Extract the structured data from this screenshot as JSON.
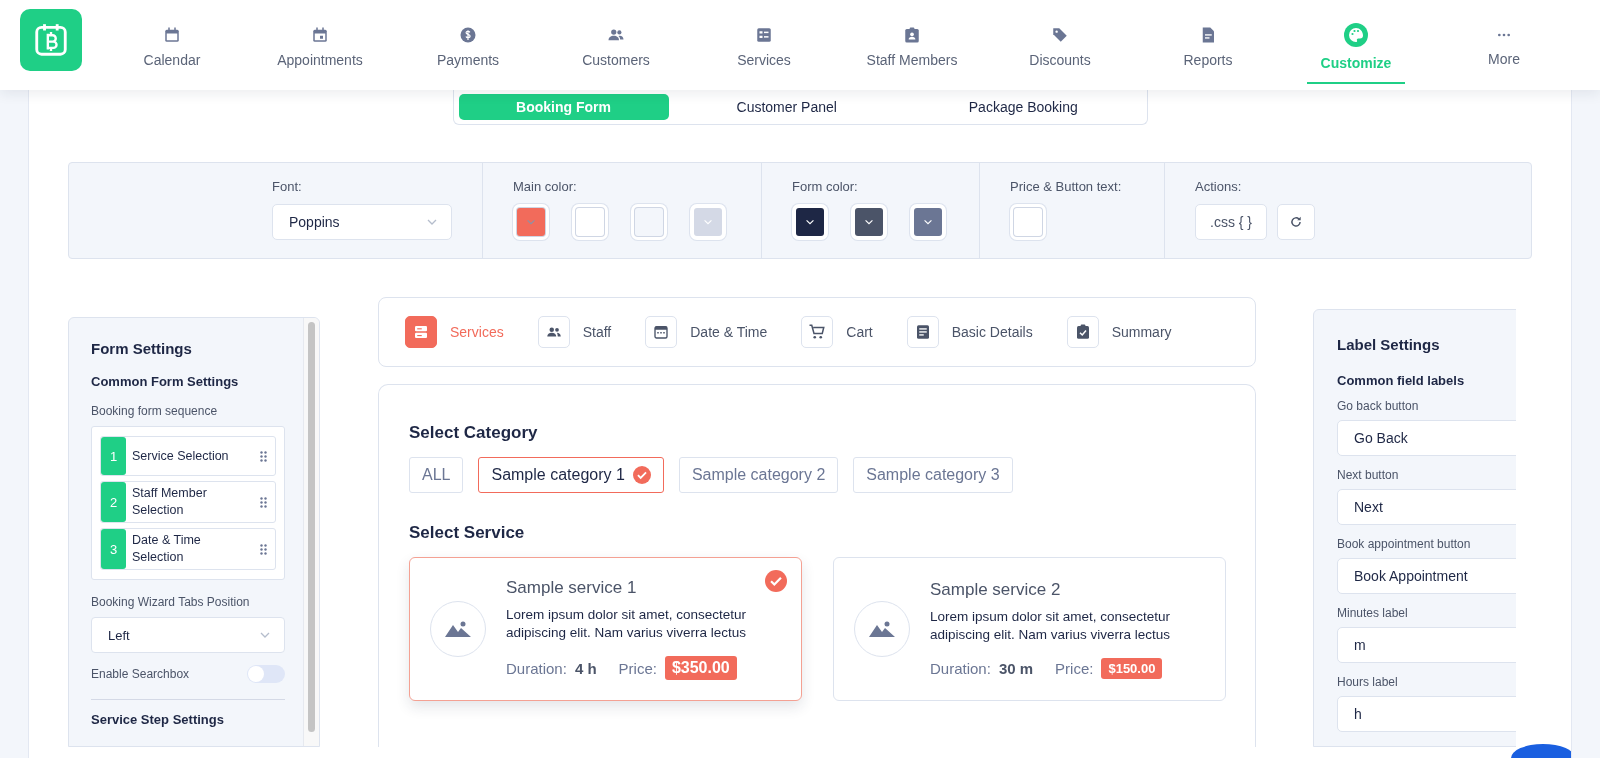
{
  "nav": {
    "items": [
      {
        "label": "Calendar",
        "selected": false
      },
      {
        "label": "Appointments",
        "selected": false
      },
      {
        "label": "Payments",
        "selected": false
      },
      {
        "label": "Customers",
        "selected": false
      },
      {
        "label": "Services",
        "selected": false
      },
      {
        "label": "Staff Members",
        "selected": false
      },
      {
        "label": "Discounts",
        "selected": false
      },
      {
        "label": "Reports",
        "selected": false
      },
      {
        "label": "Customize",
        "selected": true
      },
      {
        "label": "More",
        "selected": false
      }
    ]
  },
  "subtabs": [
    {
      "label": "Booking Form",
      "selected": true
    },
    {
      "label": "Customer Panel",
      "selected": false
    },
    {
      "label": "Package Booking",
      "selected": false
    }
  ],
  "toolbar": {
    "font": {
      "label": "Font:",
      "value": "Poppins"
    },
    "main_color": {
      "label": "Main color:",
      "swatches": [
        {
          "color": "#f26b5b",
          "caret": true
        },
        {
          "color": "#ffffff",
          "caret": false
        },
        {
          "color": "#f3f6fb",
          "caret": false
        },
        {
          "color": "#d4d9e6",
          "caret": true
        }
      ]
    },
    "form_color": {
      "label": "Form color:",
      "swatches": [
        {
          "color": "#1e2745",
          "caret": true
        },
        {
          "color": "#4b5468",
          "caret": true
        },
        {
          "color": "#6b7694",
          "caret": true
        }
      ]
    },
    "text_color": {
      "label": "Price & Button text:",
      "swatches": [
        {
          "color": "#ffffff",
          "caret": false
        }
      ]
    },
    "actions": {
      "label": "Actions:",
      "css_button": ".css { }"
    }
  },
  "form_settings": {
    "title": "Form Settings",
    "subtitle": "Common Form Settings",
    "sequence_label": "Booking form sequence",
    "sequence": [
      {
        "number": "1",
        "label": "Service Selection"
      },
      {
        "number": "2",
        "label": "Staff Member Selection"
      },
      {
        "number": "3",
        "label": "Date & Time Selection"
      }
    ],
    "tabs_position_label": "Booking Wizard Tabs Position",
    "tabs_position": "Left",
    "searchbox": {
      "label": "Enable Searchbox",
      "on": false
    },
    "next_section": "Service Step Settings"
  },
  "steps": [
    {
      "label": "Services",
      "selected": true
    },
    {
      "label": "Staff",
      "selected": false
    },
    {
      "label": "Date & Time",
      "selected": false
    },
    {
      "label": "Cart",
      "selected": false
    },
    {
      "label": "Basic Details",
      "selected": false
    },
    {
      "label": "Summary",
      "selected": false
    }
  ],
  "categories": {
    "heading": "Select Category",
    "chips": [
      {
        "label": "ALL",
        "selected": false
      },
      {
        "label": "Sample category 1",
        "selected": true
      },
      {
        "label": "Sample category 2",
        "selected": false
      },
      {
        "label": "Sample category 3",
        "selected": false
      }
    ]
  },
  "services": {
    "heading": "Select Service",
    "cards": [
      {
        "title": "Sample service 1",
        "description": "Lorem ipsum dolor sit amet, consectetur adipiscing elit. Nam varius viverra lectus",
        "duration_label": "Duration:",
        "duration": "4 h",
        "price_label": "Price:",
        "price": "$350.00",
        "selected": true
      },
      {
        "title": "Sample service 2",
        "description": "Lorem ipsum dolor sit amet, consectetur adipiscing elit. Nam varius viverra lectus",
        "duration_label": "Duration:",
        "duration": "30 m",
        "price_label": "Price:",
        "price": "$150.00",
        "selected": false
      }
    ]
  },
  "label_settings": {
    "title": "Label Settings",
    "subtitle": "Common field labels",
    "fields": [
      {
        "label": "Go back button",
        "value": "Go Back"
      },
      {
        "label": "Next button",
        "value": "Next"
      },
      {
        "label": "Book appointment button",
        "value": "Book Appointment"
      },
      {
        "label": "Minutes label",
        "value": "m"
      },
      {
        "label": "Hours label",
        "value": "h"
      }
    ]
  }
}
